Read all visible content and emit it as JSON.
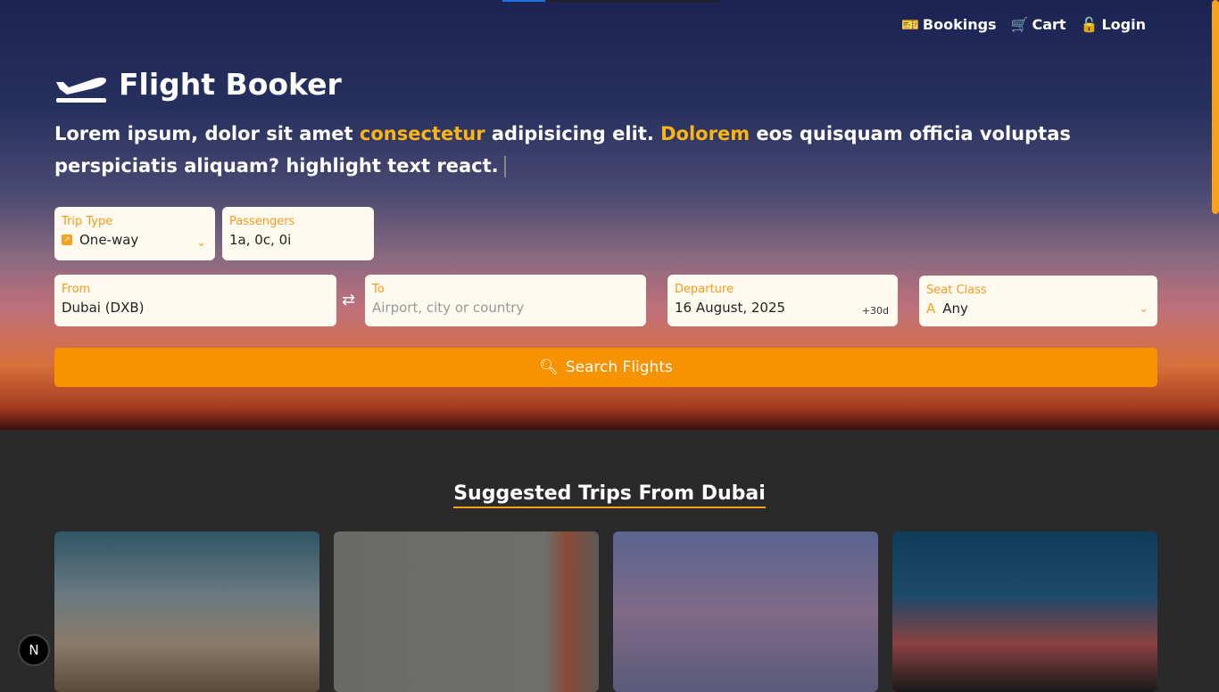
{
  "nav": {
    "bookings": "Bookings",
    "cart": "Cart",
    "login": "Login"
  },
  "brand": "Flight Booker",
  "tagline": {
    "p1": "Lorem ipsum, dolor sit amet ",
    "h1": "consectetur",
    "p2": " adipisicing elit. ",
    "h2": "Dolorem",
    "p3": " eos quisquam officia voluptas perspiciatis aliquam? highlight text react."
  },
  "form": {
    "trip_type": {
      "label": "Trip Type",
      "value": "One-way"
    },
    "passengers": {
      "label": "Passengers",
      "value": "1a, 0c, 0i"
    },
    "from": {
      "label": "From",
      "value": "Dubai (DXB)"
    },
    "to": {
      "label": "To",
      "placeholder": "Airport, city or country"
    },
    "departure": {
      "label": "Departure",
      "value": "16 August, 2025",
      "offset": "+30d"
    },
    "seat_class": {
      "label": "Seat Class",
      "icon": "A",
      "value": "Any"
    },
    "search": "Search Flights"
  },
  "suggested_title": "Suggested Trips From Dubai",
  "badge": "N",
  "colors": {
    "accent": "#f79200",
    "highlight": "#fcb514"
  }
}
